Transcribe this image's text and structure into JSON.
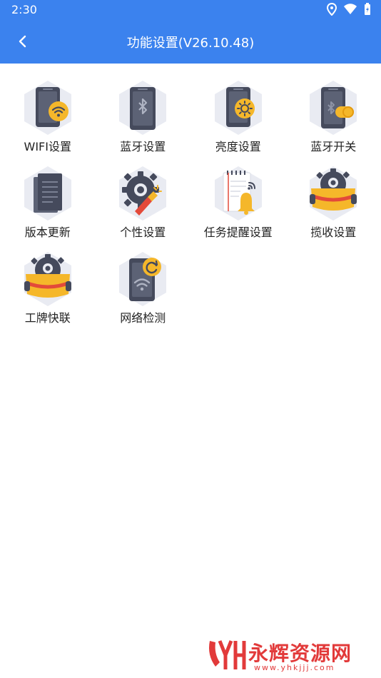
{
  "status_bar": {
    "time": "2:30"
  },
  "header": {
    "title": "功能设置(V26.10.48)"
  },
  "items": [
    {
      "label": "WIFI设置",
      "icon": "wifi-settings-icon"
    },
    {
      "label": "蓝牙设置",
      "icon": "bluetooth-settings-icon"
    },
    {
      "label": "亮度设置",
      "icon": "brightness-settings-icon"
    },
    {
      "label": "蓝牙开关",
      "icon": "bluetooth-switch-icon"
    },
    {
      "label": "版本更新",
      "icon": "version-update-icon"
    },
    {
      "label": "个性设置",
      "icon": "personalization-icon"
    },
    {
      "label": "任务提醒设置",
      "icon": "task-reminder-icon"
    },
    {
      "label": "揽收设置",
      "icon": "pickup-settings-icon"
    },
    {
      "label": "工牌快联",
      "icon": "badge-quick-connect-icon"
    },
    {
      "label": "网络检测",
      "icon": "network-check-icon"
    }
  ],
  "watermark": {
    "brand": "永辉资源网",
    "url": "www.yhkjjj.com"
  },
  "colors": {
    "header": "#3b82ee",
    "accent": "#f5b72a",
    "device": "#454a5c",
    "hex_bg": "#e9ebf2"
  }
}
